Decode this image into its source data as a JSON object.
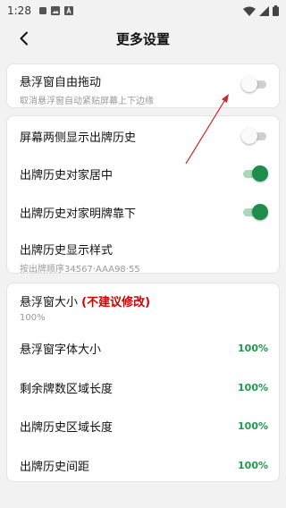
{
  "status_bar": {
    "time": "1:28"
  },
  "header": {
    "title": "更多设置"
  },
  "card1": {
    "float_drag": {
      "label": "悬浮窗自由拖动",
      "sub": "取消悬浮窗自动紧贴屏幕上下边缘",
      "enabled": false
    }
  },
  "card2": {
    "both_sides": {
      "label": "屏幕两侧显示出牌历史",
      "enabled": false
    },
    "opposite_center": {
      "label": "出牌历史对家居中",
      "enabled": true
    },
    "opposite_ming": {
      "label": "出牌历史对家明牌靠下",
      "enabled": true
    },
    "display_style": {
      "label": "出牌历史显示样式",
      "sub": "按出牌顺序34567·AAA98·55"
    }
  },
  "card3": {
    "window_size": {
      "label": "悬浮窗大小 ",
      "warn": "(不建议修改)",
      "value": "100%"
    },
    "font_size": {
      "label": "悬浮窗字体大小",
      "value": "100%"
    },
    "remaining_len": {
      "label": "剩余牌数区域长度",
      "value": "100%"
    },
    "history_len": {
      "label": "出牌历史区域长度",
      "value": "100%"
    },
    "history_spacing": {
      "label": "出牌历史间距",
      "value": "100%"
    }
  },
  "colors": {
    "accent": "#1e8c4a",
    "percent": "#1e9a4f",
    "warn": "#d40000",
    "annotation_arrow": "#cc2a2a"
  }
}
